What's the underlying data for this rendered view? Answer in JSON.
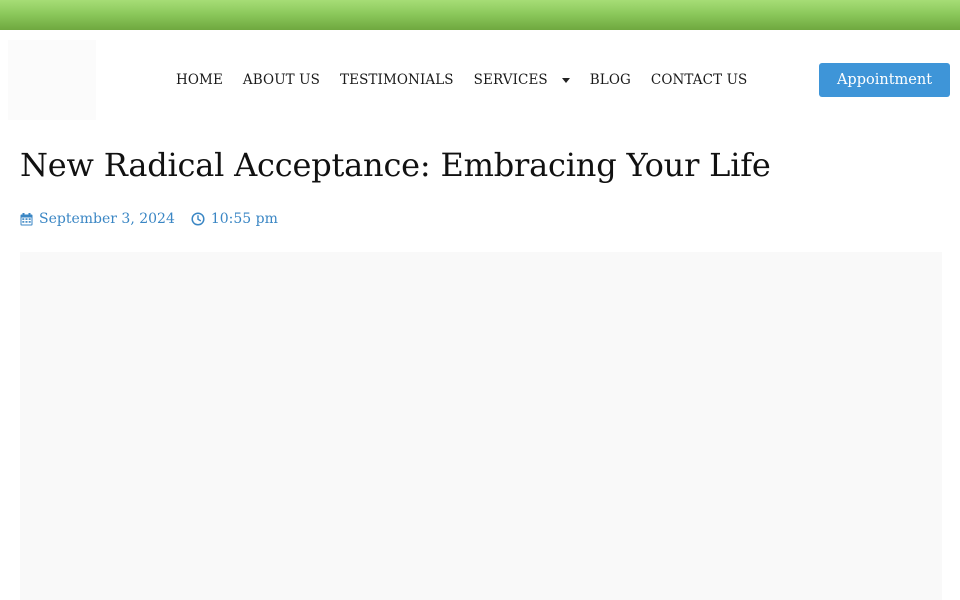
{
  "header": {
    "nav": [
      {
        "label": "HOME"
      },
      {
        "label": "ABOUT US"
      },
      {
        "label": "TESTIMONIALS"
      },
      {
        "label": "SERVICES",
        "has_dropdown": true
      },
      {
        "label": "BLOG"
      },
      {
        "label": "CONTACT US"
      }
    ],
    "cta_label": "Appointment"
  },
  "post": {
    "title": "New Radical Acceptance: Embracing Your Life",
    "date": "September 3, 2024",
    "time": "10:55 pm"
  },
  "icons": {
    "date": "calendar-icon",
    "time": "clock-icon",
    "dropdown": "chevron-down-icon"
  },
  "colors": {
    "top_bar": "#8cc95c",
    "accent": "#3e95d8",
    "meta_text": "#3a86c4",
    "text": "#111111"
  }
}
